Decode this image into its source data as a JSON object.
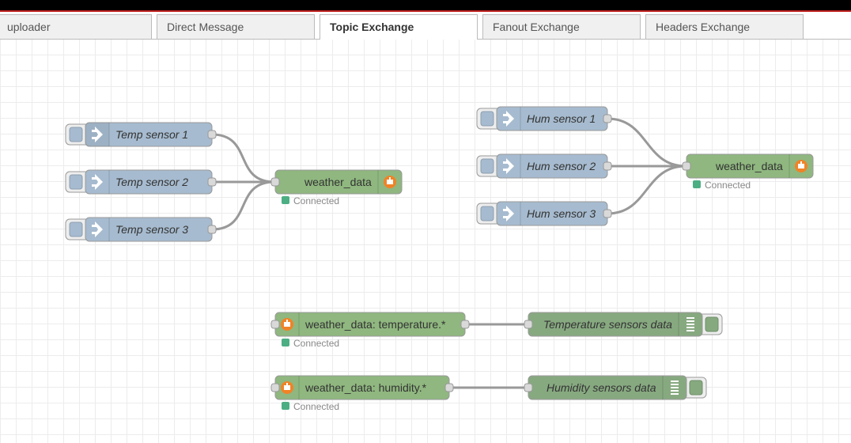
{
  "tabs": [
    {
      "label": "uploader",
      "active": false
    },
    {
      "label": "Direct Message",
      "active": false
    },
    {
      "label": "Topic Exchange",
      "active": true
    },
    {
      "label": "Fanout Exchange",
      "active": false
    },
    {
      "label": "Headers Exchange",
      "active": false
    }
  ],
  "colors": {
    "inject_node": "#a6bbcf",
    "amqp_node": "#87a980",
    "amqp_out_node": "#8fb77f",
    "debug_node": "#87a980",
    "status_connected": "#4cae83",
    "wire": "#999999",
    "amqp_icon": "#f08327"
  },
  "nodes": {
    "temp1": {
      "label": "Temp sensor 1",
      "type": "inject",
      "icon": "inject-arrow-icon"
    },
    "temp2": {
      "label": "Temp sensor 2",
      "type": "inject",
      "icon": "inject-arrow-icon"
    },
    "temp3": {
      "label": "Temp sensor 3",
      "type": "inject",
      "icon": "inject-arrow-icon"
    },
    "weather_out_temp": {
      "label": "weather_data",
      "type": "amqp-out",
      "icon": "amqp-icon",
      "status": "Connected"
    },
    "hum1": {
      "label": "Hum sensor 1",
      "type": "inject",
      "icon": "inject-arrow-icon"
    },
    "hum2": {
      "label": "Hum sensor 2",
      "type": "inject",
      "icon": "inject-arrow-icon"
    },
    "hum3": {
      "label": "Hum sensor 3",
      "type": "inject",
      "icon": "inject-arrow-icon"
    },
    "weather_out_hum": {
      "label": "weather_data",
      "type": "amqp-out",
      "icon": "amqp-icon",
      "status": "Connected"
    },
    "in_temperature": {
      "label": "weather_data: temperature.*",
      "type": "amqp-in",
      "icon": "amqp-icon",
      "status": "Connected"
    },
    "in_humidity": {
      "label": "weather_data: humidity.*",
      "type": "amqp-in",
      "icon": "amqp-icon",
      "status": "Connected"
    },
    "debug_temp": {
      "label": "Temperature sensors data",
      "type": "debug",
      "icon": "debug-list-icon"
    },
    "debug_hum": {
      "label": "Humidity sensors data",
      "type": "debug",
      "icon": "debug-list-icon"
    }
  }
}
